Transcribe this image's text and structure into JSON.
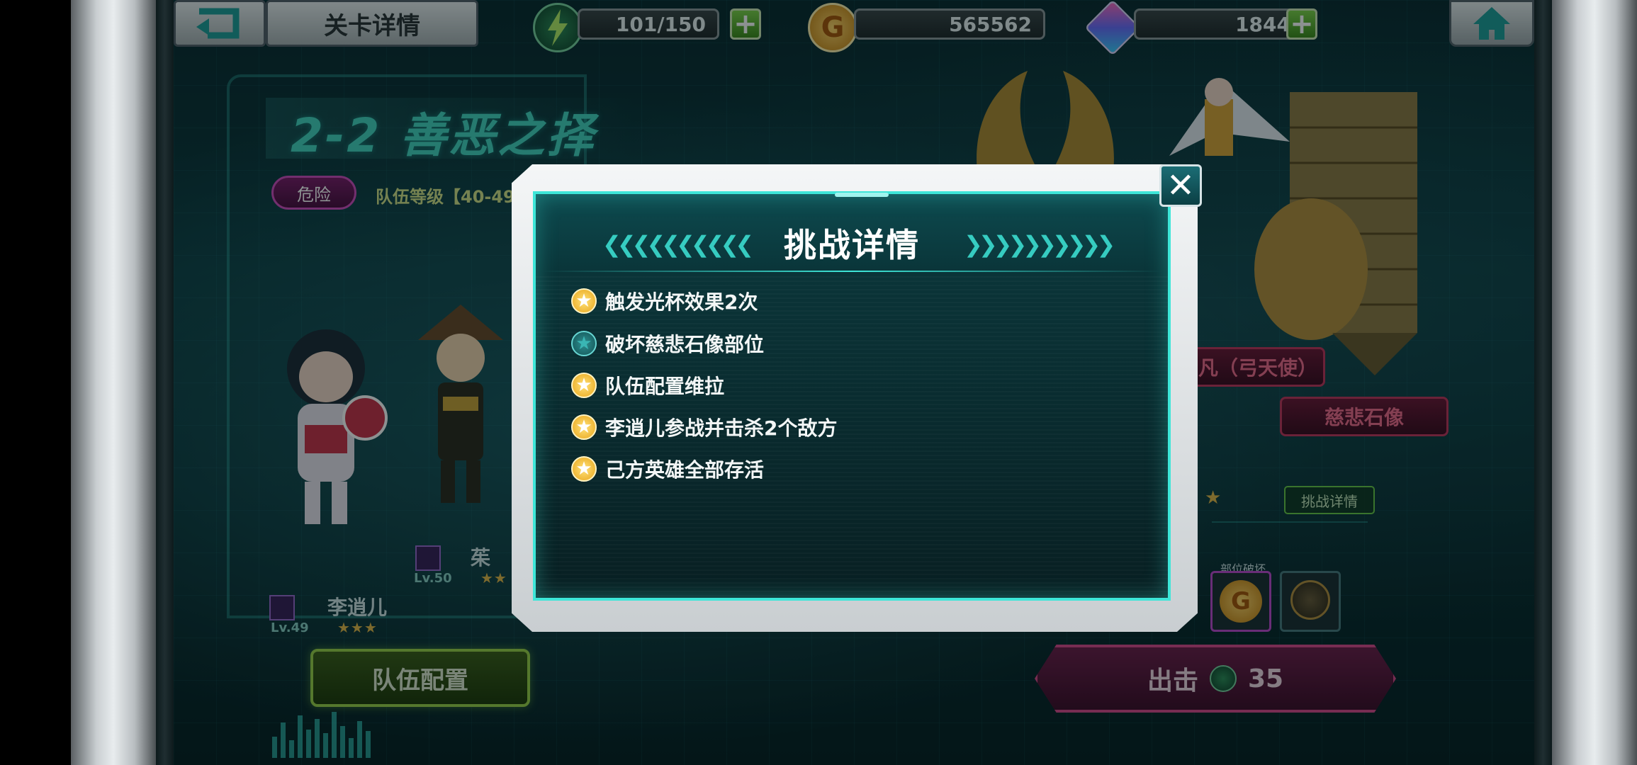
{
  "header": {
    "page_title": "关卡详情",
    "stamina": "101/150",
    "gold": "565562",
    "gems": "1844"
  },
  "stage": {
    "title": "2-2 善恶之择",
    "danger_label": "危险",
    "team_level": "队伍等级【40-49",
    "heroes": [
      {
        "name": "李逍儿",
        "level": "Lv.49",
        "stars": "★★★"
      },
      {
        "name": "茱",
        "level": "Lv.50",
        "stars": "★★"
      }
    ],
    "team_config_label": "队伍配置"
  },
  "enemies": {
    "boss_1": "凡（弓天使）",
    "boss_2": "慈悲石像",
    "challenge_details_label": "挑战详情",
    "part_break_label": "部位破坏",
    "attack_label": "出击",
    "attack_cost": "35"
  },
  "modal": {
    "title": "挑战详情",
    "objectives": [
      {
        "text": "触发光杯效果2次",
        "achieved": true
      },
      {
        "text": "破坏慈悲石像部位",
        "achieved": false
      },
      {
        "text": "队伍配置维拉",
        "achieved": true
      },
      {
        "text": "李逍儿参战并击杀2个敌方",
        "achieved": true
      },
      {
        "text": "己方英雄全部存活",
        "achieved": true
      }
    ]
  },
  "colors": {
    "accent_teal": "#3ee6d8",
    "gold_star": "#e8a51a",
    "danger_magenta": "#d04ec0",
    "attack_pink": "#d94a8c",
    "team_green": "#9bd24a"
  },
  "icons": {
    "back": "back-arrow-icon",
    "stamina": "lightning-icon",
    "gold": "gold-coin-icon",
    "gem": "gem-cube-icon",
    "home": "home-icon",
    "close": "close-icon",
    "star": "star-icon"
  }
}
